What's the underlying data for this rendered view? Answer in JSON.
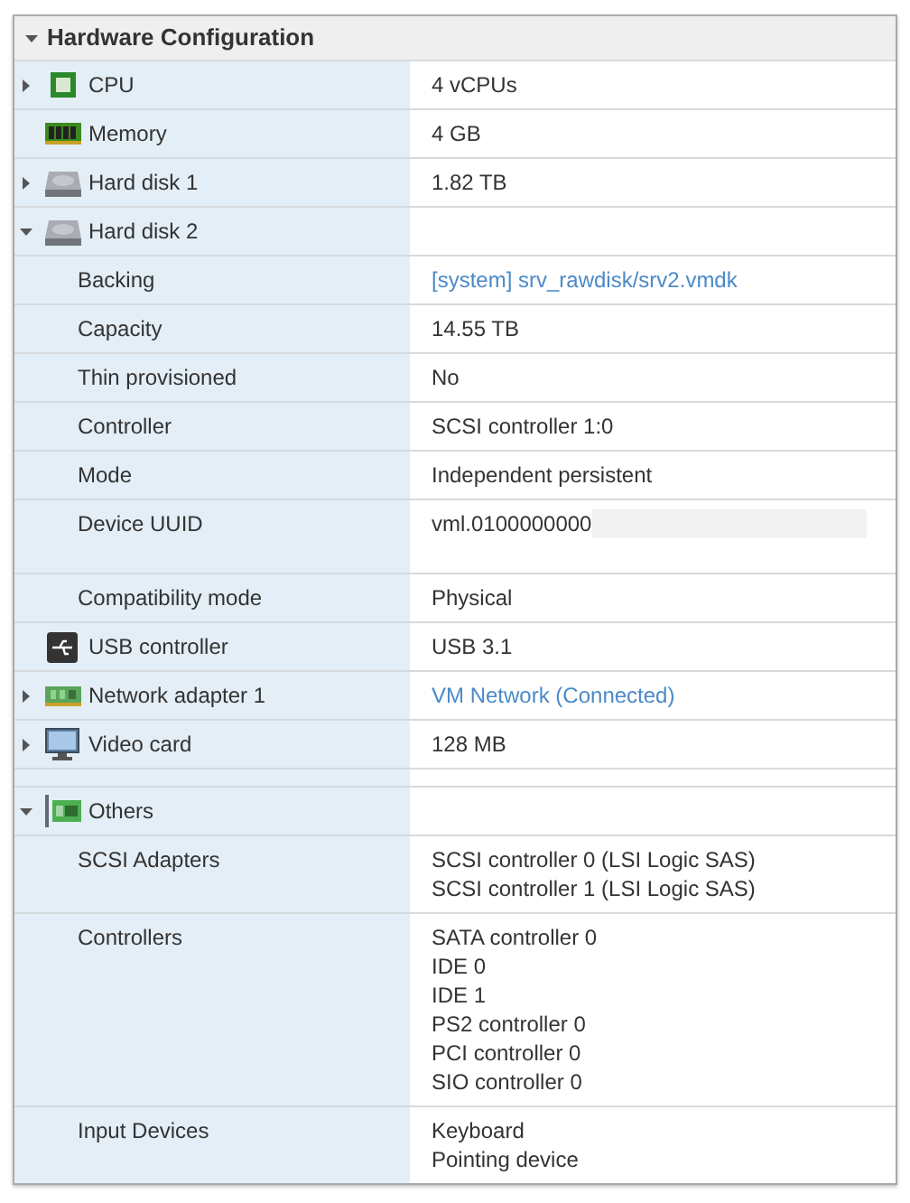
{
  "panel": {
    "title": "Hardware Configuration",
    "expanded": true
  },
  "rows": [
    {
      "kind": "cpu",
      "label": "CPU",
      "expanded": false,
      "value": [
        "4 vCPUs"
      ]
    },
    {
      "kind": "memory",
      "label": "Memory",
      "value": [
        "4 GB"
      ]
    },
    {
      "kind": "disk",
      "label": "Hard disk 1",
      "expanded": false,
      "value": [
        "1.82 TB"
      ]
    },
    {
      "kind": "disk",
      "label": "Hard disk 2",
      "expanded": true,
      "children": [
        {
          "label": "Backing",
          "value": [
            "[system] srv_rawdisk/srv2.vmdk"
          ],
          "link": true
        },
        {
          "label": "Capacity",
          "value": [
            "14.55 TB"
          ]
        },
        {
          "label": "Thin provisioned",
          "value": [
            "No"
          ]
        },
        {
          "label": "Controller",
          "value": [
            "SCSI controller 1:0"
          ]
        },
        {
          "label": "Mode",
          "value": [
            "Independent persistent"
          ]
        },
        {
          "label": "Device UUID",
          "value": [
            "vml.0100000000"
          ],
          "redacted": true
        },
        {
          "label": "Compatibility mode",
          "value": [
            "Physical"
          ]
        }
      ]
    },
    {
      "kind": "usb",
      "label": "USB controller",
      "value": [
        "USB 3.1"
      ]
    },
    {
      "kind": "network",
      "label": "Network adapter 1",
      "expanded": false,
      "value": [
        "VM Network (Connected)"
      ],
      "link": true
    },
    {
      "kind": "video",
      "label": "Video card",
      "expanded": false,
      "value": [
        "128 MB"
      ]
    },
    {
      "kind": "blank"
    },
    {
      "kind": "others",
      "label": "Others",
      "expanded": true,
      "children": [
        {
          "label": "SCSI Adapters",
          "value": [
            "SCSI controller 0 (LSI Logic SAS)",
            "SCSI controller 1 (LSI Logic SAS)"
          ]
        },
        {
          "label": "Controllers",
          "value": [
            "SATA controller 0",
            "IDE 0",
            "IDE 1",
            "PS2 controller 0",
            "PCI controller 0",
            "SIO controller 0"
          ]
        },
        {
          "label": "Input Devices",
          "value": [
            "Keyboard",
            "Pointing device"
          ]
        }
      ]
    }
  ]
}
